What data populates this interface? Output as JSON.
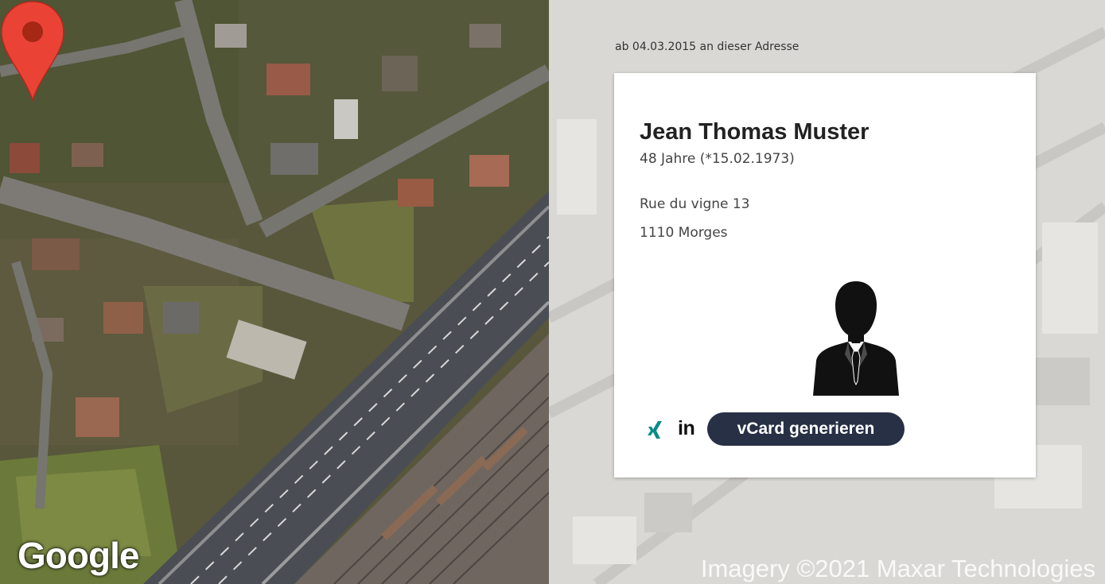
{
  "map": {
    "google_logo": "Google",
    "pin_icon": "location-pin-icon",
    "pin_color": "#ea4335"
  },
  "background": {
    "imagery_credit": "Imagery ©2021 Maxar Technologies"
  },
  "since_label": "ab 04.03.2015 an dieser Adresse",
  "card": {
    "name": "Jean Thomas Muster",
    "age": "48 Jahre (*15.02.1973)",
    "street": "Rue du vigne 13",
    "city": "1110 Morges",
    "avatar_icon": "person-silhouette-icon",
    "xing_icon": "xing-icon",
    "linkedin_icon": "linkedin-icon",
    "linkedin_text": "in",
    "vcard_button": "vCard generieren",
    "button_color": "#273044"
  }
}
